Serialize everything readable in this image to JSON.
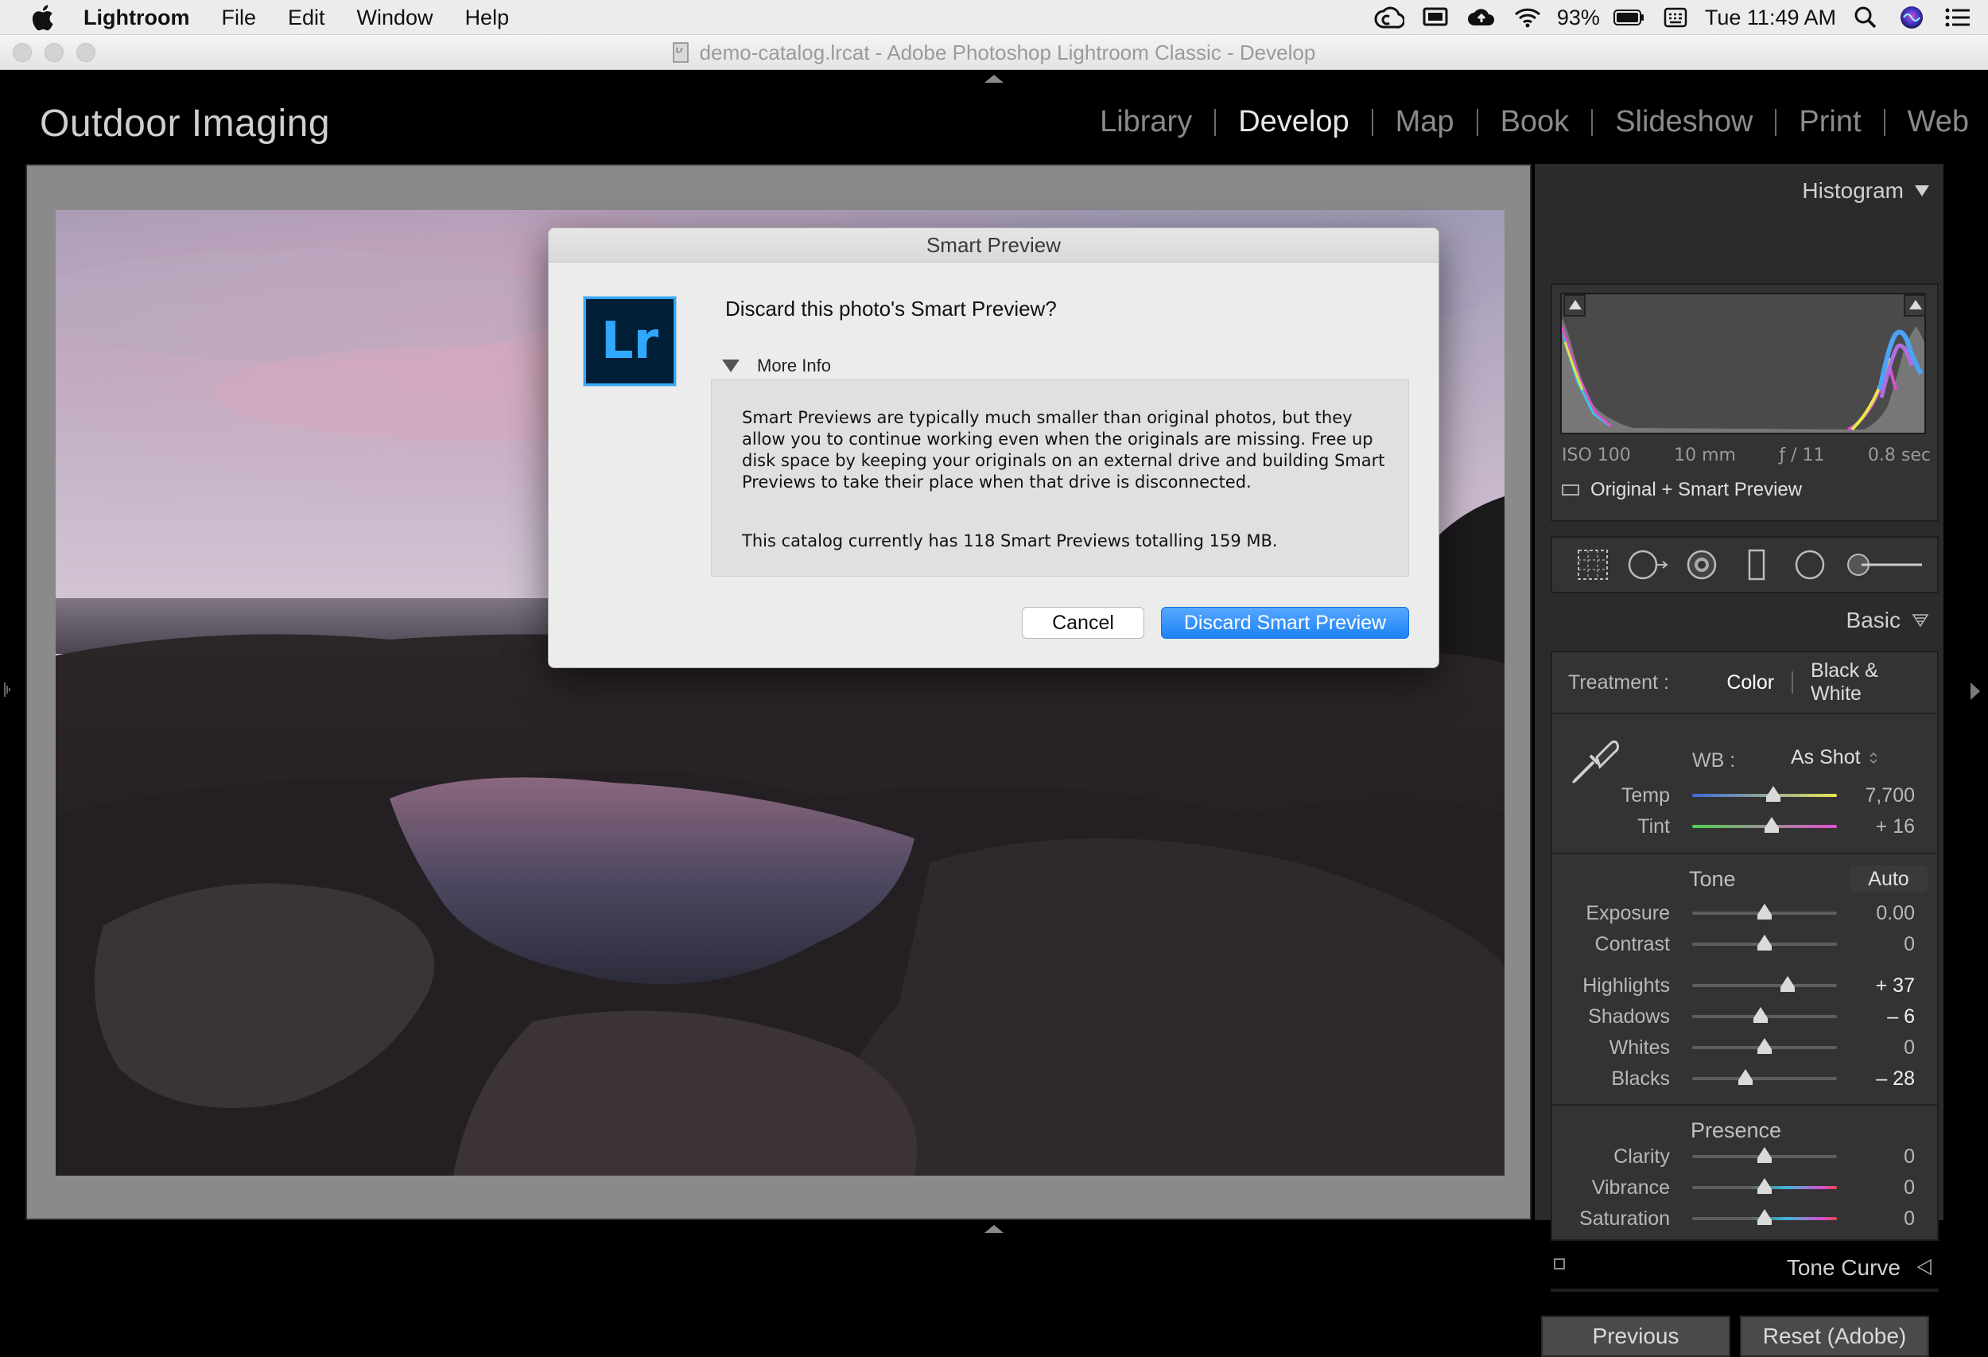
{
  "menubar": {
    "app": "Lightroom",
    "items": [
      "File",
      "Edit",
      "Window",
      "Help"
    ],
    "battery": "93%",
    "clock": "Tue 11:49 AM"
  },
  "window": {
    "title": "demo-catalog.lrcat - Adobe Photoshop Lightroom Classic - Develop"
  },
  "identity_plate": "Outdoor Imaging",
  "modules": [
    {
      "label": "Library",
      "active": false
    },
    {
      "label": "Develop",
      "active": true
    },
    {
      "label": "Map",
      "active": false
    },
    {
      "label": "Book",
      "active": false
    },
    {
      "label": "Slideshow",
      "active": false
    },
    {
      "label": "Print",
      "active": false
    },
    {
      "label": "Web",
      "active": false
    }
  ],
  "histogram": {
    "title": "Histogram",
    "iso": "ISO 100",
    "focal": "10 mm",
    "aperture": "ƒ / 11",
    "shutter": "0.8 sec",
    "status": "Original + Smart Preview"
  },
  "basic": {
    "title": "Basic",
    "treatment_label": "Treatment :",
    "treatment_color": "Color",
    "treatment_bw": "Black & White",
    "wb_label": "WB :",
    "wb_value": "As Shot",
    "tone_label": "Tone",
    "auto_label": "Auto",
    "presence_label": "Presence",
    "sliders": {
      "temp": {
        "label": "Temp",
        "value": "7,700",
        "pos": 0.56
      },
      "tint": {
        "label": "Tint",
        "value": "+ 16",
        "pos": 0.55
      },
      "exposure": {
        "label": "Exposure",
        "value": "0.00",
        "pos": 0.5
      },
      "contrast": {
        "label": "Contrast",
        "value": "0",
        "pos": 0.5
      },
      "highlights": {
        "label": "Highlights",
        "value": "+ 37",
        "pos": 0.66
      },
      "shadows": {
        "label": "Shadows",
        "value": "– 6",
        "pos": 0.47
      },
      "whites": {
        "label": "Whites",
        "value": "0",
        "pos": 0.5
      },
      "blacks": {
        "label": "Blacks",
        "value": "– 28",
        "pos": 0.37
      },
      "clarity": {
        "label": "Clarity",
        "value": "0",
        "pos": 0.5
      },
      "vibrance": {
        "label": "Vibrance",
        "value": "0",
        "pos": 0.5
      },
      "saturation": {
        "label": "Saturation",
        "value": "0",
        "pos": 0.5
      }
    }
  },
  "tone_curve": "Tone Curve",
  "buttons": {
    "previous": "Previous",
    "reset": "Reset (Adobe)"
  },
  "dialog": {
    "title": "Smart Preview",
    "logo": "Lr",
    "question": "Discard this photo's Smart Preview?",
    "more_info": "More Info",
    "info_lines": [
      "Smart Previews are typically much smaller than original photos, but they",
      "allow you to continue working even when the originals are missing. Free up",
      "disk space by keeping your originals on an external drive and building Smart",
      "Previews to take their place when that drive is disconnected."
    ],
    "catalog_info": "This catalog currently has 118 Smart Previews totalling 159 MB.",
    "cancel": "Cancel",
    "discard": "Discard Smart Preview"
  },
  "colors": {
    "accent_blue": "#1c82f5",
    "lr_logo_bg": "#001e36",
    "lr_logo_fg": "#31a8ff"
  }
}
